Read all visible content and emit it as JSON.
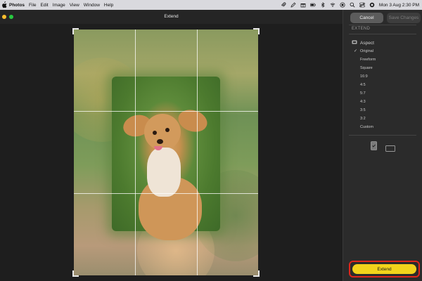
{
  "menubar": {
    "app_name": "Photos",
    "menus": [
      "File",
      "Edit",
      "Image",
      "View",
      "Window",
      "Help"
    ],
    "clock": "Mon 3 Aug  2:30 PM"
  },
  "window": {
    "title": "Extend"
  },
  "sidebar": {
    "cancel_label": "Cancel",
    "save_label": "Save Changes",
    "section_title": "EXTEND",
    "aspect_label": "Aspect",
    "aspect_options": [
      "Original",
      "Freeform",
      "Square",
      "16:9",
      "4:5",
      "5:7",
      "4:3",
      "3:5",
      "3:2",
      "Custom"
    ],
    "selected_option": "Original",
    "extend_label": "Extend"
  },
  "colors": {
    "accent": "#f2d31b",
    "highlight": "#e0261c",
    "close": "#fbbd2e",
    "zoom": "#28c840"
  }
}
